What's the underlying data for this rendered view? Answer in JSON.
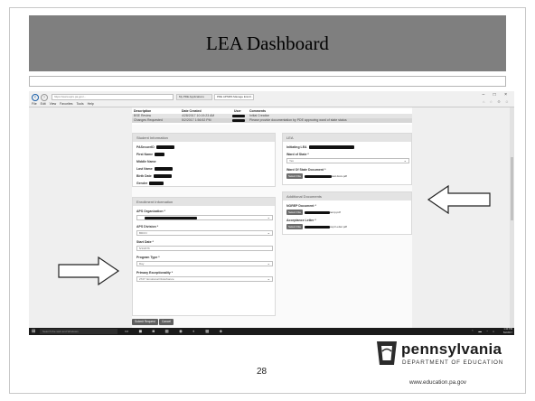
{
  "slide": {
    "title": "LEA Dashboard",
    "page_number": "28"
  },
  "branding": {
    "name": "pennsylvania",
    "department": "DEPARTMENT OF EDUCATION",
    "url": "www.education.pa.gov"
  },
  "browser": {
    "url": "https://www.aprs.pa.gov/...",
    "tabs": [
      "My PDE Applications",
      "PDE APSMS Manage Enroll..."
    ],
    "menu": [
      "File",
      "Edit",
      "View",
      "Favorites",
      "Tools",
      "Help"
    ],
    "window_controls": "– □ ×"
  },
  "history": {
    "headers": [
      "Description",
      "Date Created",
      "User",
      "Comments"
    ],
    "rows": [
      [
        "BSE Review",
        "4/28/2017 10:19:23 AM",
        "",
        "Initial Creation"
      ],
      [
        "Changes Requested",
        "5/2/2017 1:56:52 PM",
        "",
        "Please provide documentation by PDE approving ward of state status"
      ]
    ]
  },
  "student_info": {
    "title": "Student Information",
    "fields": [
      "PASecureID",
      "First Name",
      "Middle Name",
      "Last Name",
      "Birth Date",
      "Gender"
    ]
  },
  "enrollment": {
    "title": "Enrollment Information",
    "aps_org_label": "APS Organization *",
    "aps_division_label": "APS Division *",
    "aps_division_value": "BDCN",
    "start_date_label": "Start Date *",
    "start_date_value": "5/1/2076",
    "program_type_label": "Program Type *",
    "program_type_value": "Day",
    "primary_exceptionality_label": "Primary Exceptionality *",
    "primary_exceptionality_value": "2727: Emotional Disturbance"
  },
  "lea": {
    "title": "LEA",
    "initiating_lea_label": "Initiating LEA",
    "ward_label": "Ward of State *",
    "ward_value": "Yes",
    "ward_doc_label": "Ward Of State Document *",
    "ward_doc_button": "Select File",
    "ward_doc_file": "test docs.pdf"
  },
  "additional_docs": {
    "title": "Additional Documents",
    "norep_label": "NOREP Document *",
    "norep_button": "Select File",
    "norep_file": "temp.pdf",
    "acceptance_label": "Acceptance Letter *",
    "acceptance_button": "Select File",
    "acceptance_file": "cept Letter.pdf"
  },
  "actions": {
    "submit": "Submit Request",
    "cancel": "Cancel"
  },
  "taskbar": {
    "search_placeholder": "Search the web and Windows",
    "time": "1:43 PM",
    "date": "5/2/2017"
  }
}
